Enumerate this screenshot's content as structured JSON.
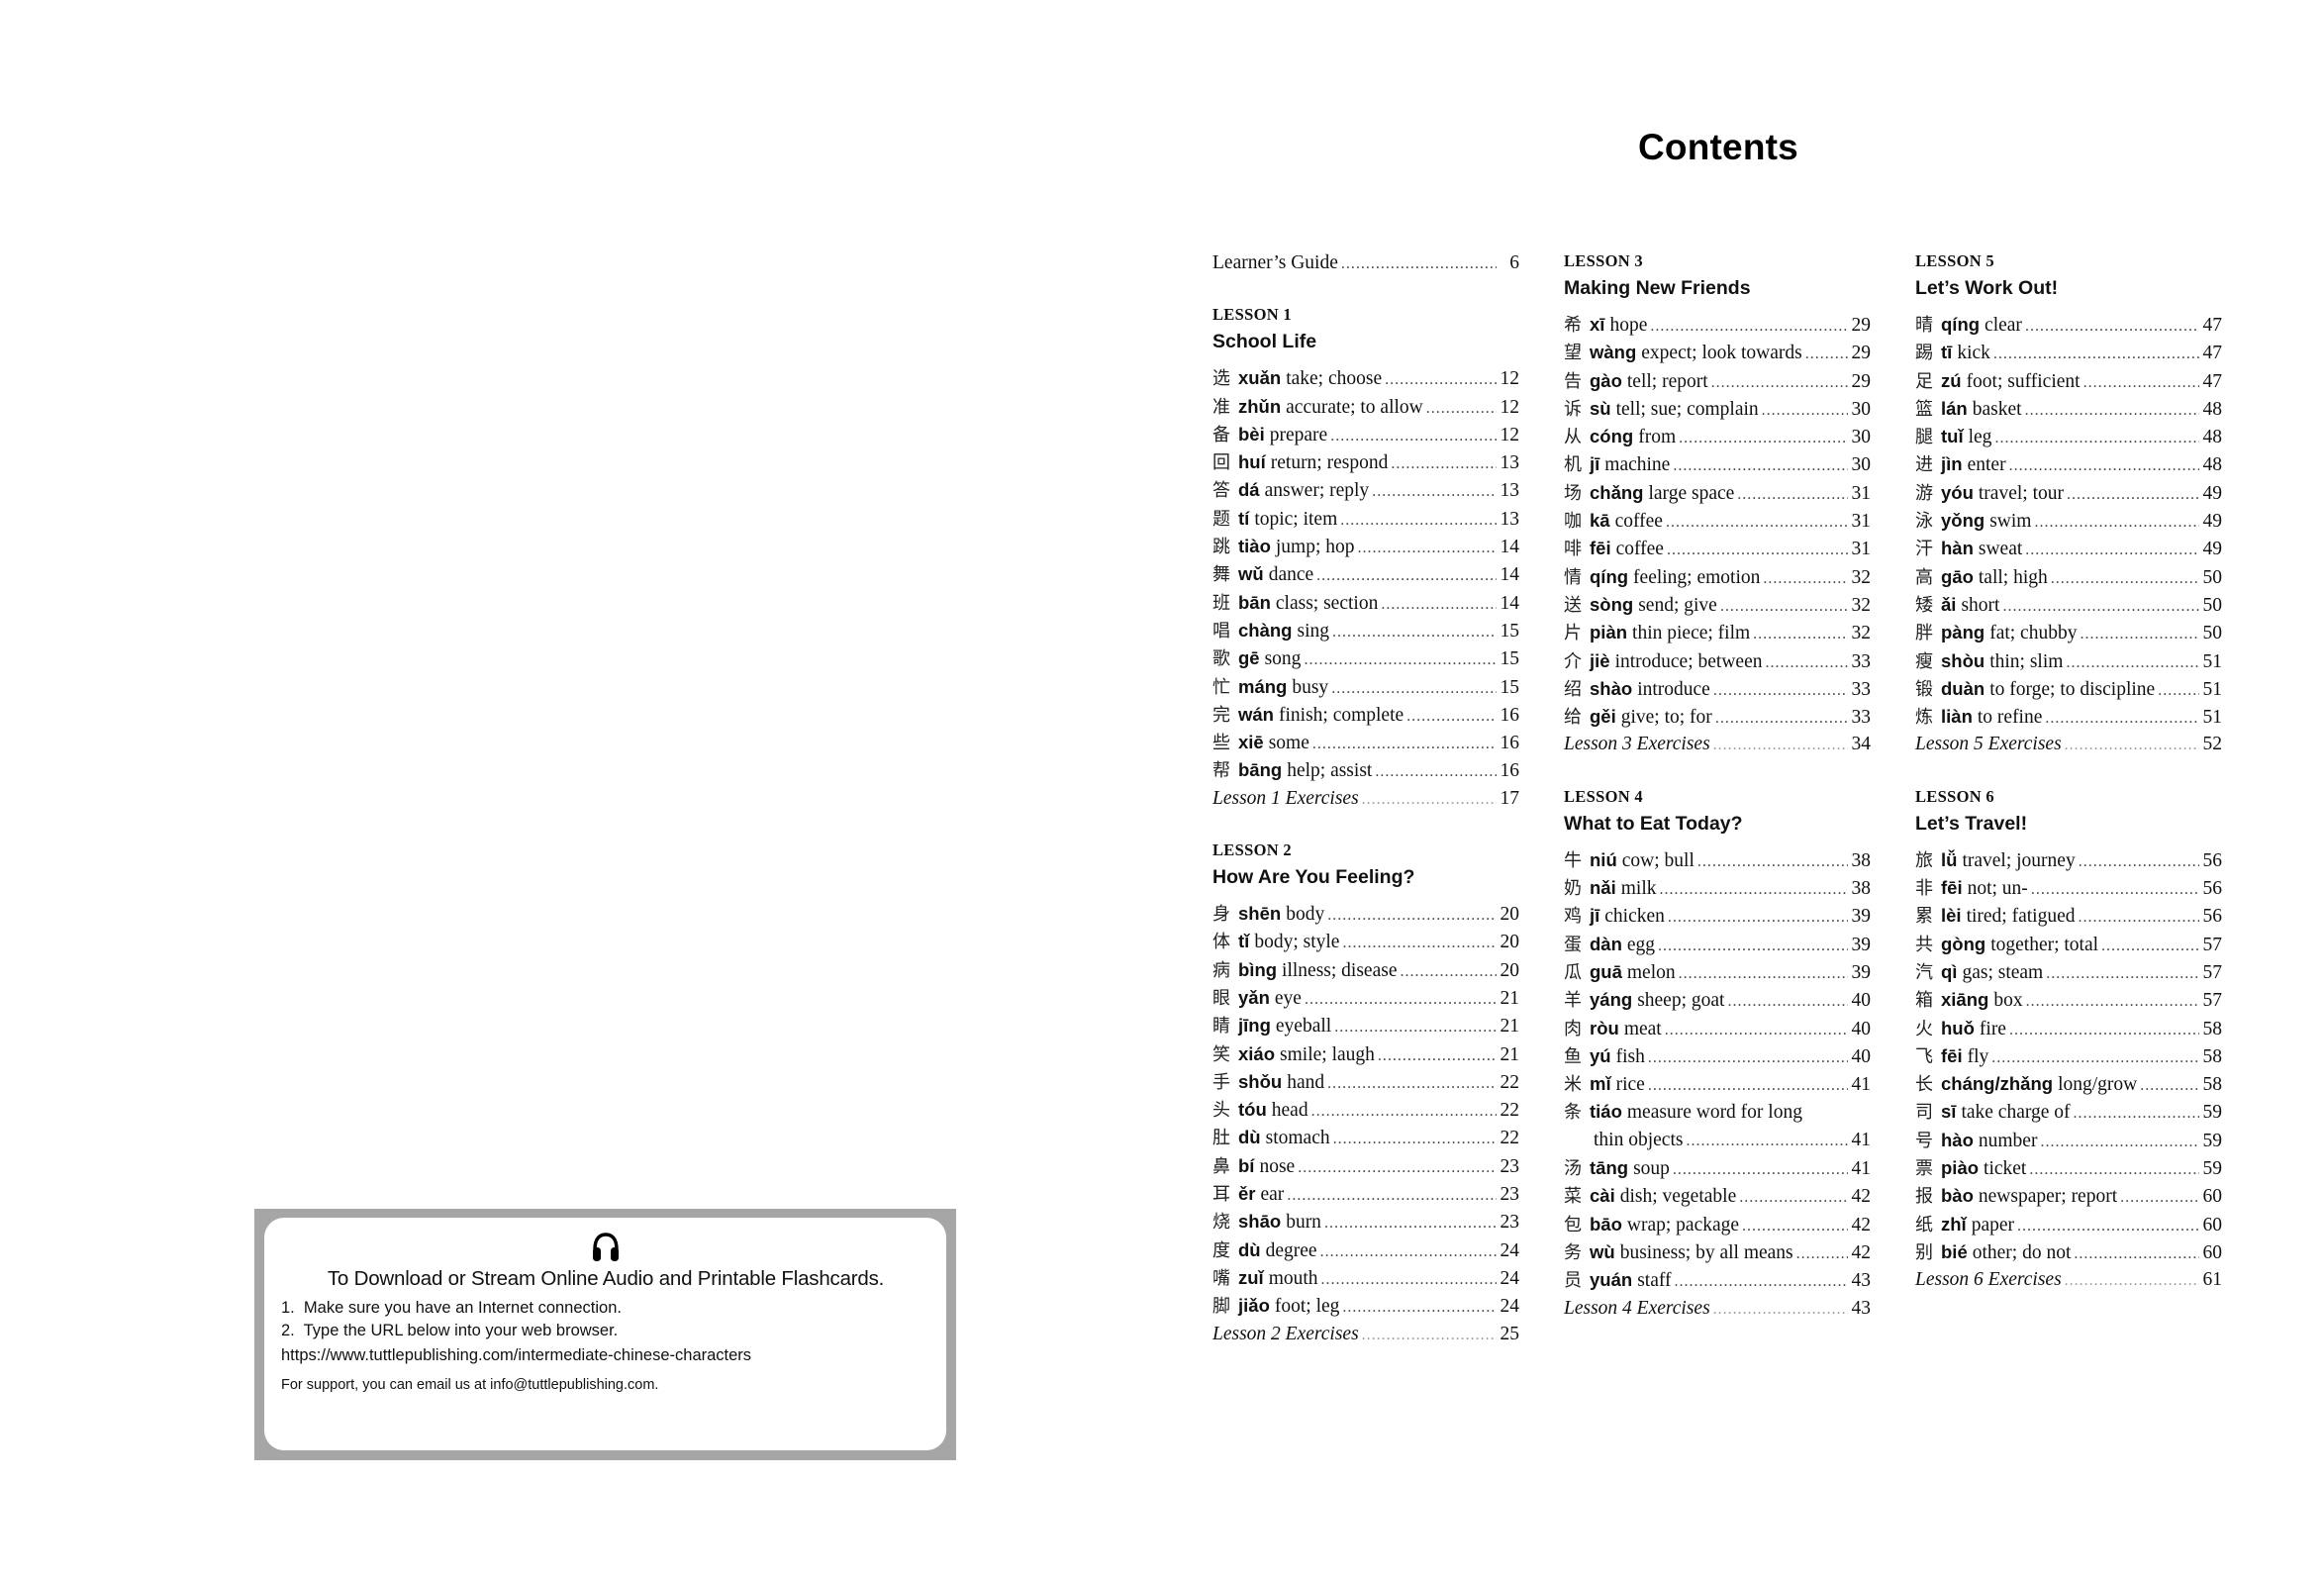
{
  "page_title": "Contents",
  "learners_guide": {
    "text": "Learner’s Guide",
    "page": "6"
  },
  "lessons": [
    {
      "label": "LESSON 1",
      "title": "School Life",
      "entries": [
        {
          "hz": "选",
          "py": "xuǎn",
          "meaning": "take; choose",
          "page": "12"
        },
        {
          "hz": "准",
          "py": "zhǔn",
          "meaning": "accurate; to allow",
          "page": "12"
        },
        {
          "hz": "备",
          "py": "bèi",
          "meaning": "prepare",
          "page": "12"
        },
        {
          "hz": "回",
          "py": "huí",
          "meaning": "return; respond",
          "page": "13"
        },
        {
          "hz": "答",
          "py": "dá",
          "meaning": "answer; reply",
          "page": "13"
        },
        {
          "hz": "题",
          "py": "tí",
          "meaning": "topic; item",
          "page": "13"
        },
        {
          "hz": "跳",
          "py": "tiào",
          "meaning": "jump; hop",
          "page": "14"
        },
        {
          "hz": "舞",
          "py": "wǔ",
          "meaning": "dance",
          "page": "14"
        },
        {
          "hz": "班",
          "py": "bān",
          "meaning": "class; section",
          "page": "14"
        },
        {
          "hz": "唱",
          "py": "chàng",
          "meaning": "sing",
          "page": "15"
        },
        {
          "hz": "歌",
          "py": "gē",
          "meaning": "song",
          "page": "15"
        },
        {
          "hz": "忙",
          "py": "máng",
          "meaning": "busy",
          "page": "15"
        },
        {
          "hz": "完",
          "py": "wán",
          "meaning": "finish; complete",
          "page": "16"
        },
        {
          "hz": "些",
          "py": "xiē",
          "meaning": "some",
          "page": "16"
        },
        {
          "hz": "帮",
          "py": "bāng",
          "meaning": "help; assist",
          "page": "16"
        }
      ],
      "exercises": {
        "text": "Lesson 1 Exercises",
        "page": "17"
      }
    },
    {
      "label": "LESSON 2",
      "title": "How Are You Feeling?",
      "entries": [
        {
          "hz": "身",
          "py": "shēn",
          "meaning": "body",
          "page": "20"
        },
        {
          "hz": "体",
          "py": "tǐ",
          "meaning": "body; style",
          "page": "20"
        },
        {
          "hz": "病",
          "py": "bìng",
          "meaning": "illness; disease",
          "page": "20"
        },
        {
          "hz": "眼",
          "py": "yǎn",
          "meaning": "eye",
          "page": "21"
        },
        {
          "hz": "睛",
          "py": "jīng",
          "meaning": "eyeball",
          "page": "21"
        },
        {
          "hz": "笑",
          "py": "xiáo",
          "meaning": "smile; laugh",
          "page": "21"
        },
        {
          "hz": "手",
          "py": "shǒu",
          "meaning": "hand",
          "page": "22"
        },
        {
          "hz": "头",
          "py": "tóu",
          "meaning": "head",
          "page": "22"
        },
        {
          "hz": "肚",
          "py": "dù",
          "meaning": "stomach",
          "page": "22"
        },
        {
          "hz": "鼻",
          "py": "bí",
          "meaning": "nose",
          "page": "23"
        },
        {
          "hz": "耳",
          "py": "ěr",
          "meaning": "ear",
          "page": "23"
        },
        {
          "hz": "烧",
          "py": "shāo",
          "meaning": "burn",
          "page": "23"
        },
        {
          "hz": "度",
          "py": "dù",
          "meaning": "degree",
          "page": "24"
        },
        {
          "hz": "嘴",
          "py": "zuǐ",
          "meaning": "mouth",
          "page": "24"
        },
        {
          "hz": "脚",
          "py": "jiǎo",
          "meaning": "foot; leg",
          "page": "24"
        }
      ],
      "exercises": {
        "text": "Lesson 2 Exercises",
        "page": "25"
      }
    },
    {
      "label": "LESSON 3",
      "title": "Making New Friends",
      "entries": [
        {
          "hz": "希",
          "py": "xī",
          "meaning": "hope",
          "page": "29"
        },
        {
          "hz": "望",
          "py": "wàng",
          "meaning": "expect; look towards",
          "page": "29"
        },
        {
          "hz": "告",
          "py": "gào",
          "meaning": "tell; report",
          "page": "29"
        },
        {
          "hz": "诉",
          "py": "sù",
          "meaning": "tell; sue; complain",
          "page": "30"
        },
        {
          "hz": "从",
          "py": "cóng",
          "meaning": "from",
          "page": "30"
        },
        {
          "hz": "机",
          "py": "jī",
          "meaning": "machine",
          "page": "30"
        },
        {
          "hz": "场",
          "py": "chǎng",
          "meaning": "large space",
          "page": "31"
        },
        {
          "hz": "咖",
          "py": "kā",
          "meaning": "coffee",
          "page": "31"
        },
        {
          "hz": "啡",
          "py": "fēi",
          "meaning": "coffee",
          "page": "31"
        },
        {
          "hz": "情",
          "py": "qíng",
          "meaning": "feeling; emotion",
          "page": "32"
        },
        {
          "hz": "送",
          "py": "sòng",
          "meaning": "send; give",
          "page": "32"
        },
        {
          "hz": "片",
          "py": "piàn",
          "meaning": "thin piece; film",
          "page": "32"
        },
        {
          "hz": "介",
          "py": "jiè",
          "meaning": "introduce; between",
          "page": "33"
        },
        {
          "hz": "绍",
          "py": "shào",
          "meaning": "introduce",
          "page": "33"
        },
        {
          "hz": "给",
          "py": "gěi",
          "meaning": "give; to; for",
          "page": "33"
        }
      ],
      "exercises": {
        "text": "Lesson 3 Exercises",
        "page": "34"
      }
    },
    {
      "label": "LESSON 4",
      "title": "What to Eat Today?",
      "entries": [
        {
          "hz": "牛",
          "py": "niú",
          "meaning": "cow; bull",
          "page": "38"
        },
        {
          "hz": "奶",
          "py": "nǎi",
          "meaning": "milk",
          "page": "38"
        },
        {
          "hz": "鸡",
          "py": "jī",
          "meaning": "chicken",
          "page": "39"
        },
        {
          "hz": "蛋",
          "py": "dàn",
          "meaning": "egg",
          "page": "39"
        },
        {
          "hz": "瓜",
          "py": "guā",
          "meaning": "melon",
          "page": "39"
        },
        {
          "hz": "羊",
          "py": "yáng",
          "meaning": "sheep; goat",
          "page": "40"
        },
        {
          "hz": "肉",
          "py": "ròu",
          "meaning": "meat",
          "page": "40"
        },
        {
          "hz": "鱼",
          "py": "yú",
          "meaning": "fish",
          "page": "40"
        },
        {
          "hz": "米",
          "py": "mǐ",
          "meaning": "rice",
          "page": "41"
        },
        {
          "hz": "条",
          "py": "tiáo",
          "meaning": "measure word for long",
          "continuation": "thin objects",
          "page": "41"
        },
        {
          "hz": "汤",
          "py": "tāng",
          "meaning": "soup",
          "page": "41"
        },
        {
          "hz": "菜",
          "py": "cài",
          "meaning": "dish; vegetable",
          "page": "42"
        },
        {
          "hz": "包",
          "py": "bāo",
          "meaning": "wrap; package",
          "page": "42"
        },
        {
          "hz": "务",
          "py": "wù",
          "meaning": "business; by all means",
          "page": "42"
        },
        {
          "hz": "员",
          "py": "yuán",
          "meaning": "staff",
          "page": "43"
        }
      ],
      "exercises": {
        "text": "Lesson 4 Exercises",
        "page": "43"
      }
    },
    {
      "label": "LESSON 5",
      "title": "Let’s Work Out!",
      "entries": [
        {
          "hz": "晴",
          "py": "qíng",
          "meaning": "clear",
          "page": "47"
        },
        {
          "hz": "踢",
          "py": "tī",
          "meaning": "kick",
          "page": "47"
        },
        {
          "hz": "足",
          "py": "zú",
          "meaning": "foot; sufficient",
          "page": "47"
        },
        {
          "hz": "篮",
          "py": "lán",
          "meaning": "basket",
          "page": "48"
        },
        {
          "hz": "腿",
          "py": "tuǐ",
          "meaning": "leg",
          "page": "48"
        },
        {
          "hz": "进",
          "py": "jìn",
          "meaning": "enter",
          "page": "48"
        },
        {
          "hz": "游",
          "py": "yóu",
          "meaning": "travel; tour",
          "page": "49"
        },
        {
          "hz": "泳",
          "py": "yǒng",
          "meaning": "swim",
          "page": "49"
        },
        {
          "hz": "汗",
          "py": "hàn",
          "meaning": "sweat",
          "page": "49"
        },
        {
          "hz": "高",
          "py": "gāo",
          "meaning": "tall; high",
          "page": "50"
        },
        {
          "hz": "矮",
          "py": "ǎi",
          "meaning": "short",
          "page": "50"
        },
        {
          "hz": "胖",
          "py": "pàng",
          "meaning": "fat; chubby",
          "page": "50"
        },
        {
          "hz": "瘦",
          "py": "shòu",
          "meaning": "thin; slim",
          "page": "51"
        },
        {
          "hz": "锻",
          "py": "duàn",
          "meaning": "to forge; to discipline",
          "page": "51"
        },
        {
          "hz": "炼",
          "py": "liàn",
          "meaning": "to refine",
          "page": "51"
        }
      ],
      "exercises": {
        "text": "Lesson 5 Exercises",
        "page": "52"
      }
    },
    {
      "label": "LESSON 6",
      "title": "Let’s Travel!",
      "entries": [
        {
          "hz": "旅",
          "py": "lǚ",
          "meaning": "travel; journey",
          "page": "56"
        },
        {
          "hz": "非",
          "py": "fēi",
          "meaning": "not; un-",
          "page": "56"
        },
        {
          "hz": "累",
          "py": "lèi",
          "meaning": "tired; fatigued",
          "page": "56"
        },
        {
          "hz": "共",
          "py": "gòng",
          "meaning": "together; total",
          "page": "57"
        },
        {
          "hz": "汽",
          "py": "qì",
          "meaning": "gas; steam",
          "page": "57"
        },
        {
          "hz": "箱",
          "py": "xiāng",
          "meaning": "box",
          "page": "57"
        },
        {
          "hz": "火",
          "py": "huǒ",
          "meaning": "fire",
          "page": "58"
        },
        {
          "hz": "飞",
          "py": "fēi",
          "meaning": "fly",
          "page": "58"
        },
        {
          "hz": "长",
          "py": "cháng/zhǎng",
          "meaning": "long/grow",
          "page": "58"
        },
        {
          "hz": "司",
          "py": "sī",
          "meaning": "take charge of",
          "page": "59"
        },
        {
          "hz": "号",
          "py": "hào",
          "meaning": "number",
          "page": "59"
        },
        {
          "hz": "票",
          "py": "piào",
          "meaning": "ticket",
          "page": "59"
        },
        {
          "hz": "报",
          "py": "bào",
          "meaning": "newspaper; report",
          "page": "60"
        },
        {
          "hz": "纸",
          "py": "zhǐ",
          "meaning": "paper",
          "page": "60"
        },
        {
          "hz": "别",
          "py": "bié",
          "meaning": "other; do not",
          "page": "60"
        }
      ],
      "exercises": {
        "text": "Lesson 6 Exercises",
        "page": "61"
      }
    }
  ],
  "audio_box": {
    "icon": "headphones-icon",
    "heading": "To Download or Stream Online Audio and Printable Flashcards.",
    "steps": [
      "1.  Make sure you have an Internet connection.",
      "2.  Type the URL below into your web browser."
    ],
    "url": "https://www.tuttlepublishing.com/intermediate-chinese-characters",
    "support": "For support, you can email us at info@tuttlepublishing.com.",
    "border_color": "#a6a6a6"
  }
}
